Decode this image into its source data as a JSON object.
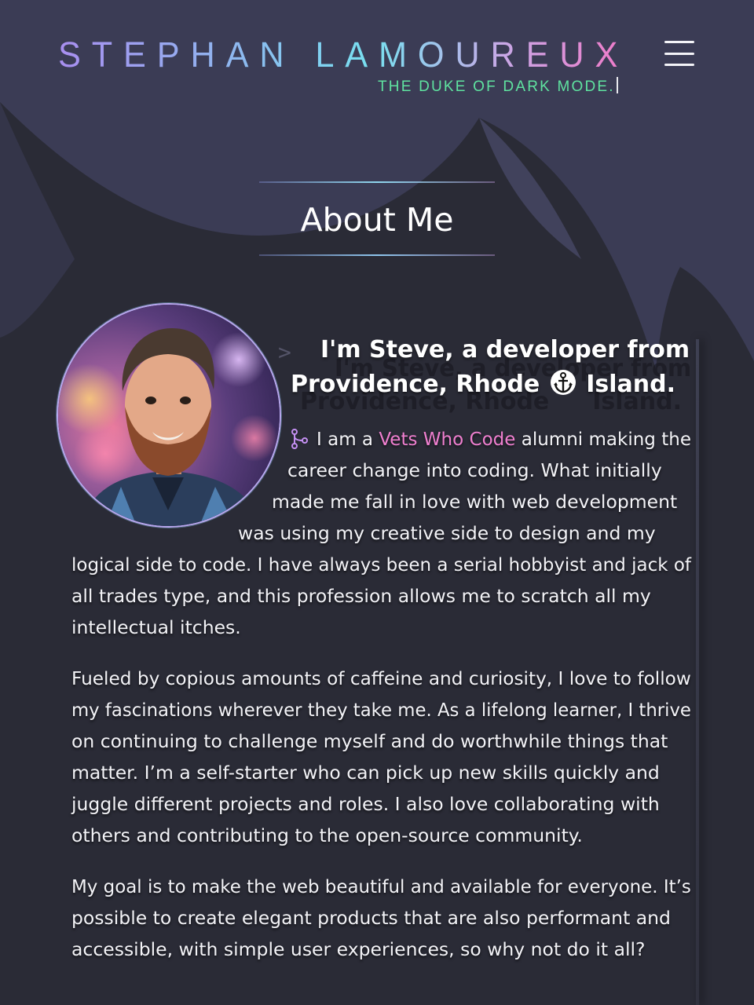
{
  "header": {
    "site_title": "STEPHAN LAMOUREUX",
    "tagline": "THE DUKE OF DARK MODE.",
    "menu_icon": "hamburger-menu-icon"
  },
  "section": {
    "title": "About Me"
  },
  "about": {
    "avatar_alt": "profile-photo",
    "intro_line1": "I'm Steve, a developer from",
    "intro_line2_before": "Providence, Rhode",
    "intro_icon": "anchor-icon",
    "intro_line2_after": "Island.",
    "p1": {
      "icon": "git-branch-icon",
      "line1_before": "I am a",
      "link": "Vets Who Code",
      "line1_after": "alumni making the",
      "line2": "career change into coding. What initially",
      "line3": "made me fall in love with web development",
      "line4": "was using my creative side to design and my",
      "line5": "logical side to code. I have always been a serial hobbyist and jack of",
      "line6": "all trades type, and this profession allows me to scratch all my",
      "line7": "intellectual itches."
    },
    "p2": [
      "Fueled by copious amounts of caffeine and curiosity, I love to follow",
      "my fascinations wherever they take me. As a lifelong learner, I thrive",
      "on continuing to challenge myself and do worthwhile things that",
      "matter. I’m a self-starter who can pick up new skills quickly and",
      "juggle different projects and roles. I also love collaborating with",
      "others and contributing to the open-source community."
    ],
    "p3": [
      "My goal is to make the web beautiful and available for everyone. It’s",
      "possible to create elegant products that are also performant and",
      "accessible, with simple user experiences, so why not do it all?"
    ]
  },
  "colors": {
    "background": "#2a2b36",
    "wave": "#3c3d55",
    "tagline": "#5fe3a0",
    "link": "#ef7fcf",
    "avatar_ring": "#b9a8ef"
  }
}
